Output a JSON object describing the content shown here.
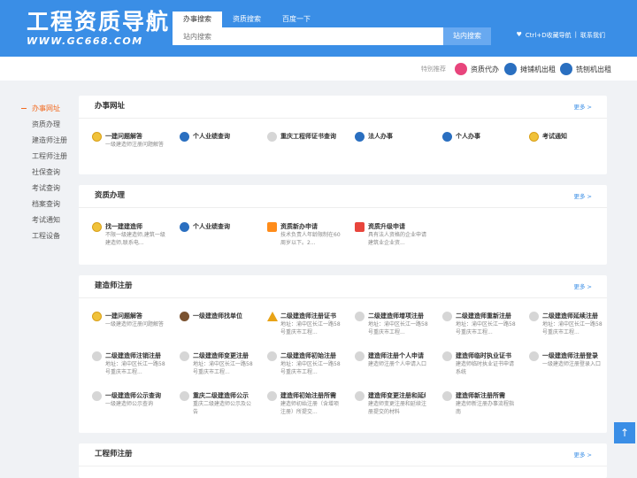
{
  "header": {
    "logo_title": "工程资质导航",
    "logo_url": "WWW.GC668.COM",
    "tabs": [
      "办事搜索",
      "资质搜索",
      "百度一下"
    ],
    "search_placeholder": "站内搜索",
    "search_button": "站内搜索",
    "bookmark": "Ctrl+D收藏导航",
    "separator": "|",
    "contact": "联系我们"
  },
  "subbar": {
    "label": "特别推荐",
    "items": [
      "资质代办",
      "摊铺机出租",
      "铣刨机出租"
    ]
  },
  "sidebar": [
    "办事网址",
    "资质办理",
    "建造师注册",
    "工程师注册",
    "社保查询",
    "考试查询",
    "档案查询",
    "考试通知",
    "工程设备"
  ],
  "sections": [
    {
      "title": "办事网址",
      "more": "更多 >",
      "items": [
        {
          "t": "一建问题解答",
          "d": "一级建造师注册问题解答"
        },
        {
          "t": "个人业绩查询",
          "d": ""
        },
        {
          "t": "重庆工程师证书查询",
          "d": ""
        },
        {
          "t": "法人办事",
          "d": ""
        },
        {
          "t": "个人办事",
          "d": ""
        },
        {
          "t": "考试通知",
          "d": ""
        }
      ]
    },
    {
      "title": "资质办理",
      "more": "更多 >",
      "items": [
        {
          "t": "找一建建造师",
          "d": "不限一级建造师,建筑一级建造师,联系电..."
        },
        {
          "t": "个人业绩查询",
          "d": ""
        },
        {
          "t": "资质新办申请",
          "d": "技术负责人年龄限制在60周岁以下。2..."
        },
        {
          "t": "资质升级申请",
          "d": "具有法人资格的企业申请建筑业企业资..."
        }
      ]
    },
    {
      "title": "建造师注册",
      "more": "更多 >",
      "items": [
        {
          "t": "一建问题解答",
          "d": "一级建造师注册问题解答"
        },
        {
          "t": "一级建造师找单位",
          "d": ""
        },
        {
          "t": "二级建造师注册证书",
          "d": "地址：渝中区长江一路58号重庆市工程..."
        },
        {
          "t": "二级建造师增项注册",
          "d": "地址：渝中区长江一路58号重庆市工程..."
        },
        {
          "t": "二级建造师重新注册",
          "d": "地址：渝中区长江一路58号重庆市工程..."
        },
        {
          "t": "二级建造师延续注册",
          "d": "地址：渝中区长江一路58号重庆市工程..."
        },
        {
          "t": "二级建造师注销注册",
          "d": "地址：渝中区长江一路58号重庆市工程..."
        },
        {
          "t": "二级建造师变更注册",
          "d": "地址：渝中区长江一路58号重庆市工程..."
        },
        {
          "t": "二级建造师初始注册",
          "d": "地址：渝中区长江一路58号重庆市工程..."
        },
        {
          "t": "建造师注册个人申请",
          "d": "建造师注册个人申请入口"
        },
        {
          "t": "建造师临时执业证书",
          "d": "建造师临时执业证书申请系统"
        },
        {
          "t": "一级建造师注册登录",
          "d": "一级建造师注册登录入口"
        },
        {
          "t": "一级建造师公示查询",
          "d": "一级建造师公示查询"
        },
        {
          "t": "重庆二级建造师公示",
          "d": "重庆二级建造师公示及公告"
        },
        {
          "t": "建造师初始注册所需",
          "d": "建造师初始注册（含增项注册）所提交..."
        },
        {
          "t": "建造师变更注册和延续",
          "d": "建造师变更注册和延续注册提交的材料"
        },
        {
          "t": "建造师新注册所需",
          "d": "建造师新注册办事流程指南"
        }
      ]
    },
    {
      "title": "工程师注册",
      "more": "更多 >",
      "items": []
    }
  ],
  "back_to_top": "↑"
}
